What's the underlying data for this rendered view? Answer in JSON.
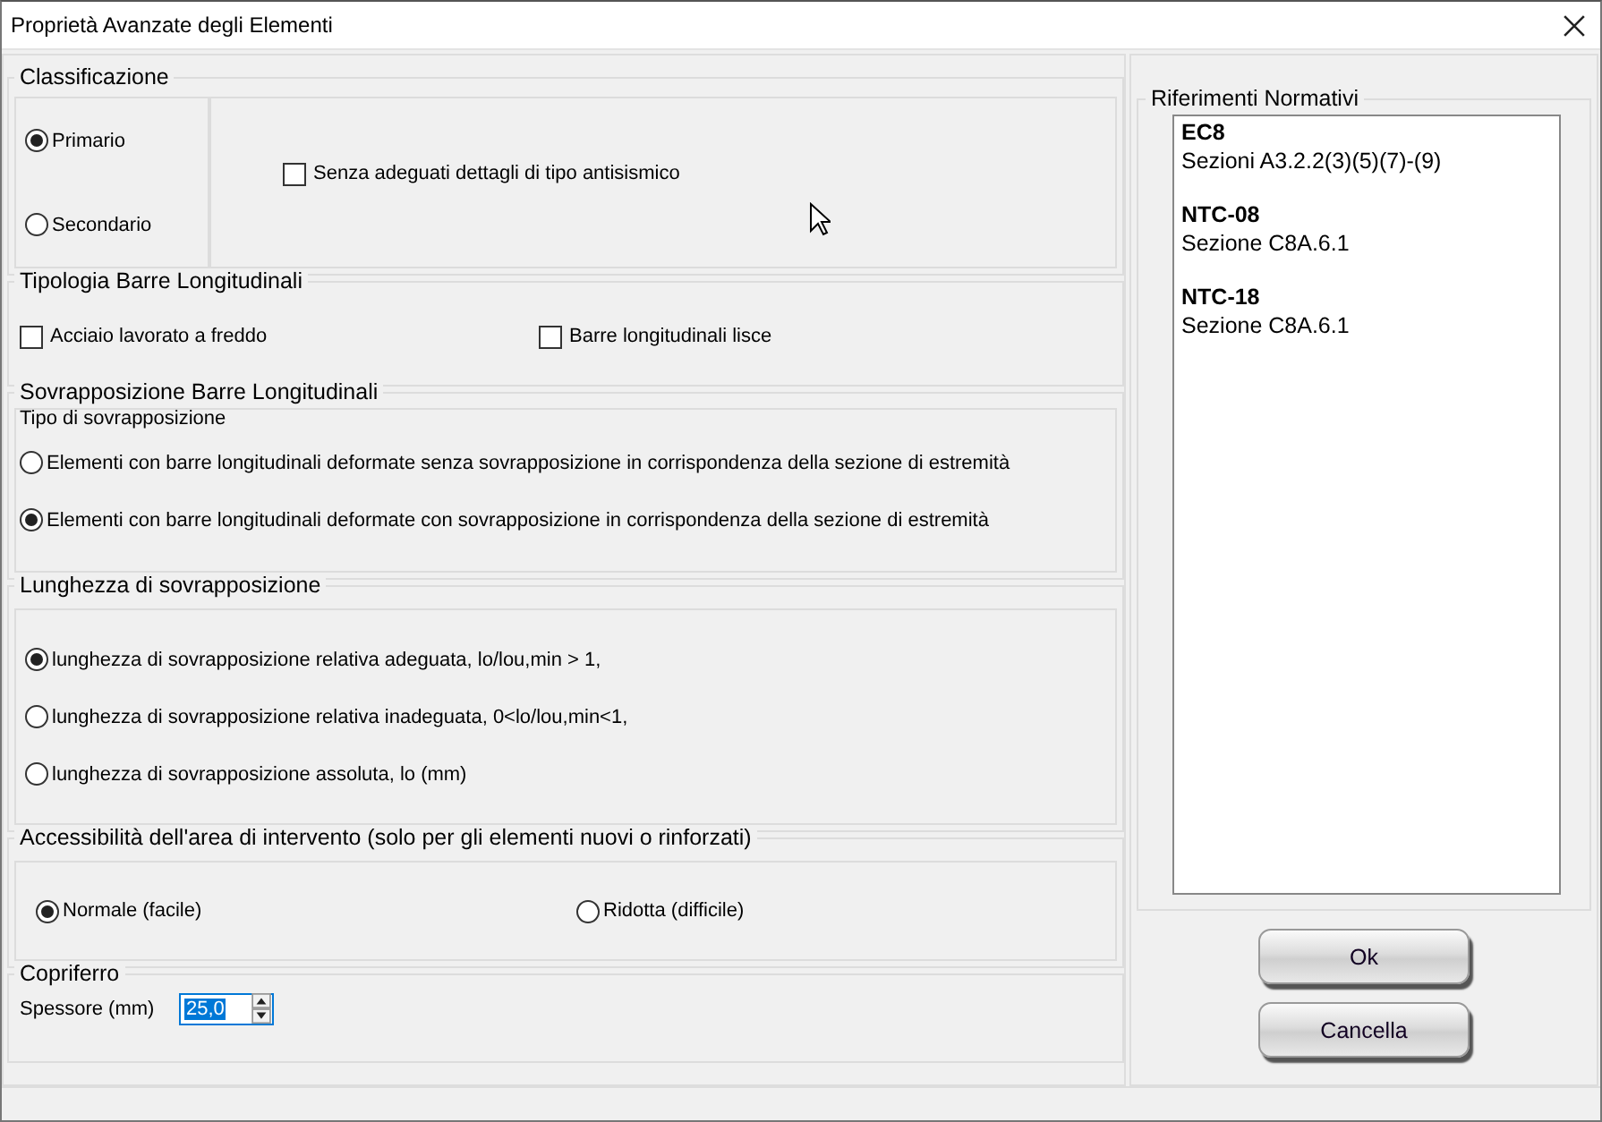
{
  "window": {
    "title": "Proprietà Avanzate degli Elementi"
  },
  "classificazione": {
    "title": "Classificazione",
    "options": [
      {
        "label": "Primario",
        "selected": true
      },
      {
        "label": "Secondario",
        "selected": false
      }
    ],
    "checkbox": {
      "label": "Senza adeguati dettagli di tipo antisismico",
      "checked": false
    }
  },
  "tipologia": {
    "title": "Tipologia Barre Longitudinali",
    "checkboxes": [
      {
        "label": "Acciaio lavorato a freddo",
        "checked": false
      },
      {
        "label": "Barre longitudinali lisce",
        "checked": false
      }
    ]
  },
  "sovrapposizione": {
    "title": "Sovrapposizione Barre Longitudinali",
    "subtitle": "Tipo di sovrapposizione",
    "options": [
      {
        "label": "Elementi con barre longitudinali deformate senza sovrapposizione in corrispondenza della sezione di estremità",
        "selected": false
      },
      {
        "label": "Elementi con barre longitudinali deformate con sovrapposizione in corrispondenza della sezione di estremità",
        "selected": true
      }
    ]
  },
  "lunghezza": {
    "title": "Lunghezza di sovrapposizione",
    "options": [
      {
        "label": "lunghezza di sovrapposizione relativa adeguata,  lo/lou,min > 1,",
        "selected": true
      },
      {
        "label": "lunghezza di sovrapposizione relativa inadeguata,  0<lo/lou,min<1,",
        "selected": false
      },
      {
        "label": "lunghezza di sovrapposizione assoluta, lo (mm)",
        "selected": false
      }
    ]
  },
  "accessibilita": {
    "title": "Accessibilità dell'area di intervento (solo per gli elementi nuovi o rinforzati)",
    "options": [
      {
        "label": "Normale (facile)",
        "selected": true
      },
      {
        "label": "Ridotta (difficile)",
        "selected": false
      }
    ]
  },
  "copriferro": {
    "title": "Copriferro",
    "label": "Spessore (mm)",
    "value": "25,0"
  },
  "riferimenti": {
    "title": "Riferimenti Normativi",
    "entries": [
      {
        "code": "EC8",
        "section": "Sezioni A3.2.2(3)(5)(7)-(9)"
      },
      {
        "code": "NTC-08",
        "section": "Sezione C8A.6.1"
      },
      {
        "code": "NTC-18",
        "section": "Sezione C8A.6.1"
      }
    ]
  },
  "buttons": [
    "Ok",
    "Cancella"
  ]
}
